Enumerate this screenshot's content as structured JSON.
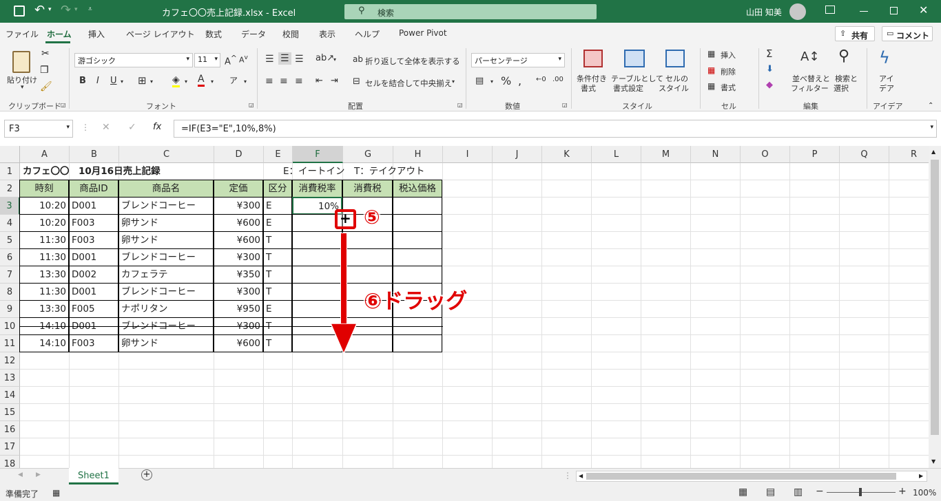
{
  "titlebar": {
    "filename": "カフェ〇〇売上記録.xlsx  -  Excel",
    "search_placeholder": "検索",
    "user": "山田 知美"
  },
  "menu": [
    "ファイル",
    "ホーム",
    "挿入",
    "ページ レイアウト",
    "数式",
    "データ",
    "校閲",
    "表示",
    "ヘルプ",
    "Power Pivot"
  ],
  "share_label": "共有",
  "comment_label": "コメント",
  "ribbon": {
    "paste": "貼り付け",
    "font_name": "游ゴシック",
    "font_size": "11",
    "wrap_text": "折り返して全体を表示する",
    "merge_center": "セルを結合して中央揃え",
    "number_format": "パーセンテージ",
    "cond_format": [
      "条件付き",
      "書式"
    ],
    "table_format": [
      "テーブルとして",
      "書式設定"
    ],
    "cell_style": [
      "セルの",
      "スタイル"
    ],
    "insert": "挿入",
    "delete": "削除",
    "format": "書式",
    "sort_filter": [
      "並べ替えと",
      "フィルター"
    ],
    "find_select": [
      "検索と",
      "選択"
    ],
    "ideas": [
      "アイ",
      "デア"
    ],
    "groups": [
      "クリップボード",
      "フォント",
      "配置",
      "数値",
      "スタイル",
      "セル",
      "編集",
      "アイデア"
    ]
  },
  "formula_bar": {
    "name_box": "F3",
    "formula": "=IF(E3=\"E\",10%,8%)"
  },
  "columns": [
    "A",
    "B",
    "C",
    "D",
    "E",
    "F",
    "G",
    "H",
    "I",
    "J",
    "K",
    "L",
    "M",
    "N",
    "O",
    "P",
    "Q",
    "R"
  ],
  "rows": [
    "1",
    "2",
    "3",
    "4",
    "5",
    "6",
    "7",
    "8",
    "9",
    "10",
    "11",
    "12",
    "13",
    "14",
    "15",
    "16",
    "17",
    "18"
  ],
  "sheet": {
    "title": "カフェ〇〇　10月16日売上記録",
    "legend": "E：イートイン　T：テイクアウト",
    "headers": [
      "時刻",
      "商品ID",
      "商品名",
      "定価",
      "区分",
      "消費税率",
      "消費税",
      "税込価格"
    ],
    "data": [
      [
        "10:20",
        "D001",
        "ブレンドコーヒー",
        "¥300",
        "E",
        "10%"
      ],
      [
        "10:20",
        "F003",
        "卵サンド",
        "¥600",
        "E",
        ""
      ],
      [
        "11:30",
        "F003",
        "卵サンド",
        "¥600",
        "T",
        ""
      ],
      [
        "11:30",
        "D001",
        "ブレンドコーヒー",
        "¥300",
        "T",
        ""
      ],
      [
        "13:30",
        "D002",
        "カフェラテ",
        "¥350",
        "T",
        ""
      ],
      [
        "11:30",
        "D001",
        "ブレンドコーヒー",
        "¥300",
        "T",
        ""
      ],
      [
        "13:30",
        "F005",
        "ナポリタン",
        "¥950",
        "E",
        ""
      ],
      [
        "14:10",
        "D001",
        "ブレンドコーヒー",
        "¥300",
        "T",
        ""
      ],
      [
        "14:10",
        "F003",
        "卵サンド",
        "¥600",
        "T",
        ""
      ]
    ]
  },
  "annotations": {
    "step5": "⑤",
    "step6": "⑥ドラッグ"
  },
  "tab": "Sheet1",
  "status": {
    "ready": "準備完了",
    "zoom": "100%"
  },
  "colors": {
    "excel_green": "#217346",
    "header_fill": "#c6e0b4",
    "annotation_red": "#e00000"
  }
}
